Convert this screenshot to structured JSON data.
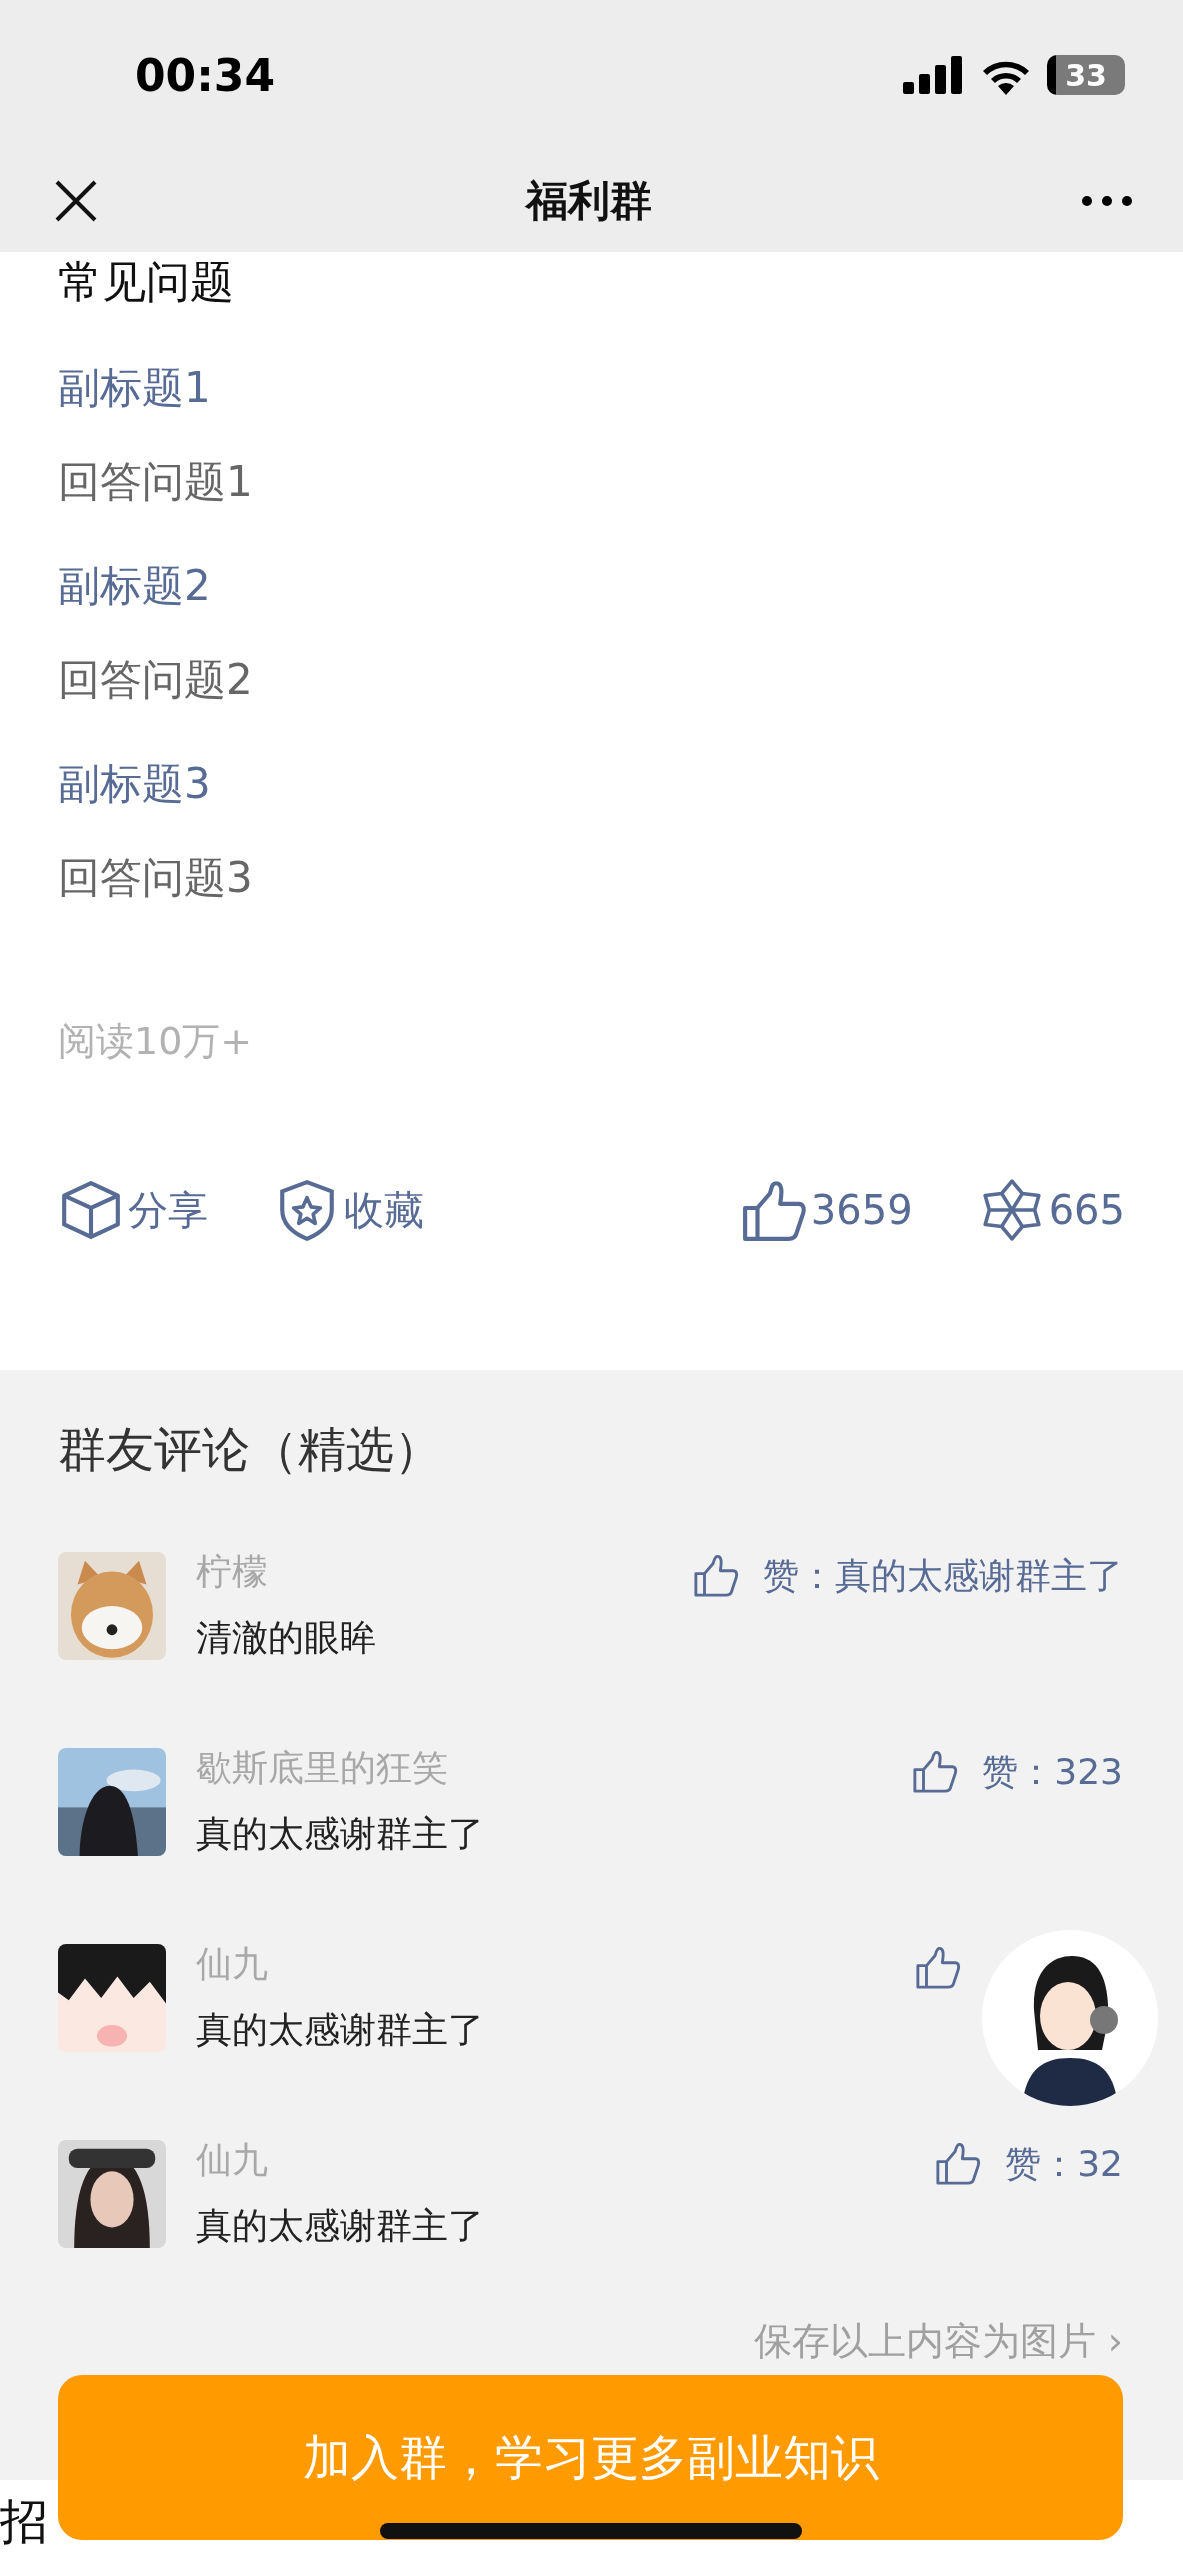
{
  "status_bar": {
    "time": "00:34",
    "battery": "33"
  },
  "nav": {
    "title": "福利群"
  },
  "article": {
    "heading": "常见问题",
    "faq": [
      {
        "subtitle": "副标题1",
        "answer": "回答问题1"
      },
      {
        "subtitle": "副标题2",
        "answer": "回答问题2"
      },
      {
        "subtitle": "副标题3",
        "answer": "回答问题3"
      }
    ],
    "reads": "阅读10万+",
    "actions": [
      {
        "kind": "share",
        "label": "分享"
      },
      {
        "kind": "favorite",
        "label": "收藏"
      },
      {
        "kind": "like",
        "label": "3659"
      },
      {
        "kind": "star",
        "label": "665"
      }
    ]
  },
  "comments": {
    "title": "群友评论（精选）",
    "items": [
      {
        "name": "柠檬",
        "text": "清澈的眼眸",
        "likes": "赞：真的太感谢群主了"
      },
      {
        "name": "歇斯底里的狂笑",
        "text": "真的太感谢群主了",
        "likes": "赞：323"
      },
      {
        "name": "仙九",
        "text": "真的太感谢群主了"
      },
      {
        "name": "仙九",
        "text": "真的太感谢群主了",
        "likes": "赞：32"
      }
    ],
    "save_link": "保存以上内容为图片 ›"
  },
  "join_button": "加入群，学习更多副业知识",
  "footer_text": "招"
}
